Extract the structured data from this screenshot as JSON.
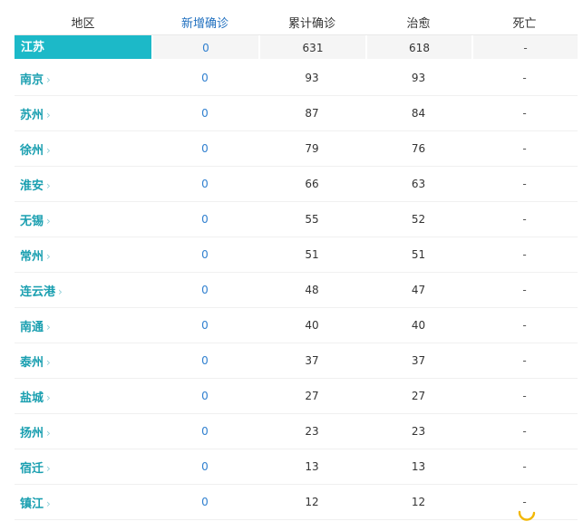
{
  "page": {
    "top_strip_text": "—— ——— —— ———— ——————"
  },
  "table": {
    "headers": {
      "region": "地区",
      "new_confirmed": "新增确诊",
      "total_confirmed": "累计确诊",
      "cured": "治愈",
      "deaths": "死亡"
    },
    "province": {
      "name": "江苏",
      "new_confirmed": "0",
      "total_confirmed": "631",
      "cured": "618",
      "deaths": "-"
    },
    "cities": [
      {
        "name": "南京",
        "new_confirmed": "0",
        "total_confirmed": "93",
        "cured": "93",
        "deaths": "-"
      },
      {
        "name": "苏州",
        "new_confirmed": "0",
        "total_confirmed": "87",
        "cured": "84",
        "deaths": "-"
      },
      {
        "name": "徐州",
        "new_confirmed": "0",
        "total_confirmed": "79",
        "cured": "76",
        "deaths": "-"
      },
      {
        "name": "淮安",
        "new_confirmed": "0",
        "total_confirmed": "66",
        "cured": "63",
        "deaths": "-"
      },
      {
        "name": "无锡",
        "new_confirmed": "0",
        "total_confirmed": "55",
        "cured": "52",
        "deaths": "-"
      },
      {
        "name": "常州",
        "new_confirmed": "0",
        "total_confirmed": "51",
        "cured": "51",
        "deaths": "-"
      },
      {
        "name": "连云港",
        "new_confirmed": "0",
        "total_confirmed": "48",
        "cured": "47",
        "deaths": "-"
      },
      {
        "name": "南通",
        "new_confirmed": "0",
        "total_confirmed": "40",
        "cured": "40",
        "deaths": "-"
      },
      {
        "name": "泰州",
        "new_confirmed": "0",
        "total_confirmed": "37",
        "cured": "37",
        "deaths": "-"
      },
      {
        "name": "盐城",
        "new_confirmed": "0",
        "total_confirmed": "27",
        "cured": "27",
        "deaths": "-"
      },
      {
        "name": "扬州",
        "new_confirmed": "0",
        "total_confirmed": "23",
        "cured": "23",
        "deaths": "-"
      },
      {
        "name": "宿迁",
        "new_confirmed": "0",
        "total_confirmed": "13",
        "cured": "13",
        "deaths": "-"
      },
      {
        "name": "镇江",
        "new_confirmed": "0",
        "total_confirmed": "12",
        "cured": "12",
        "deaths": "-"
      }
    ]
  },
  "icons": {
    "chevron": "chevron-right-icon",
    "loading": "loading-spinner-icon"
  },
  "colors": {
    "province_highlight": "#1cb9c8",
    "city_link": "#1a9fb0",
    "new_confirmed_accent": "#2f7fcf",
    "spinner": "#f2b705"
  }
}
